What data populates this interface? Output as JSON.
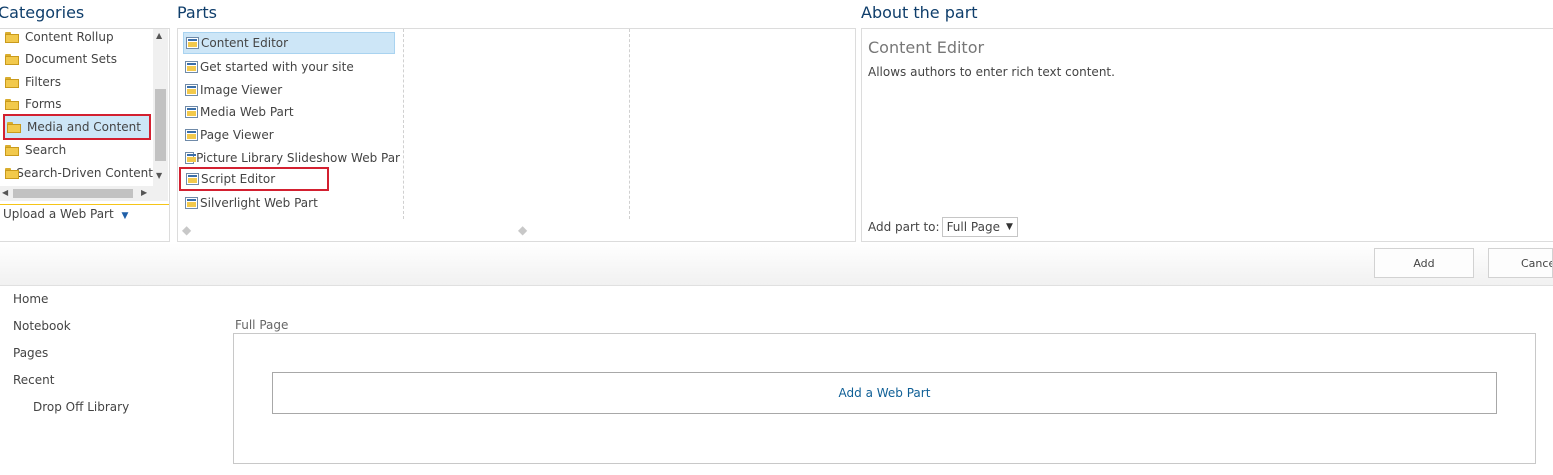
{
  "headings": {
    "categories": "Categories",
    "parts": "Parts",
    "about": "About the part"
  },
  "categories": {
    "items": [
      "Content Rollup",
      "Document Sets",
      "Filters",
      "Forms",
      "Media and Content",
      "Search",
      "Search-Driven Content"
    ],
    "selected": "Media and Content",
    "upload_label": "Upload a Web Part"
  },
  "parts": {
    "items": [
      "Content Editor",
      "Get started with your site",
      "Image Viewer",
      "Media Web Part",
      "Page Viewer",
      "Picture Library Slideshow Web Par",
      "Script Editor",
      "Silverlight Web Part"
    ],
    "selected": "Content Editor",
    "highlighted": "Script Editor"
  },
  "about": {
    "title": "Content Editor",
    "description": "Allows authors to enter rich text content.",
    "add_part_to_label": "Add part to:",
    "add_part_to_value": "Full Page"
  },
  "buttons": {
    "add": "Add",
    "cancel": "Cancel"
  },
  "left_nav": {
    "items": [
      "Home",
      "Notebook",
      "Pages",
      "Recent"
    ],
    "sub_items": [
      "Drop Off Library"
    ]
  },
  "zone": {
    "label": "Full Page",
    "add_web_part": "Add a Web Part"
  },
  "colors": {
    "heading": "#0f3e6b",
    "selection_outline": "#d32030",
    "selection_bg": "#cde6f7",
    "link": "#0f5f96"
  }
}
